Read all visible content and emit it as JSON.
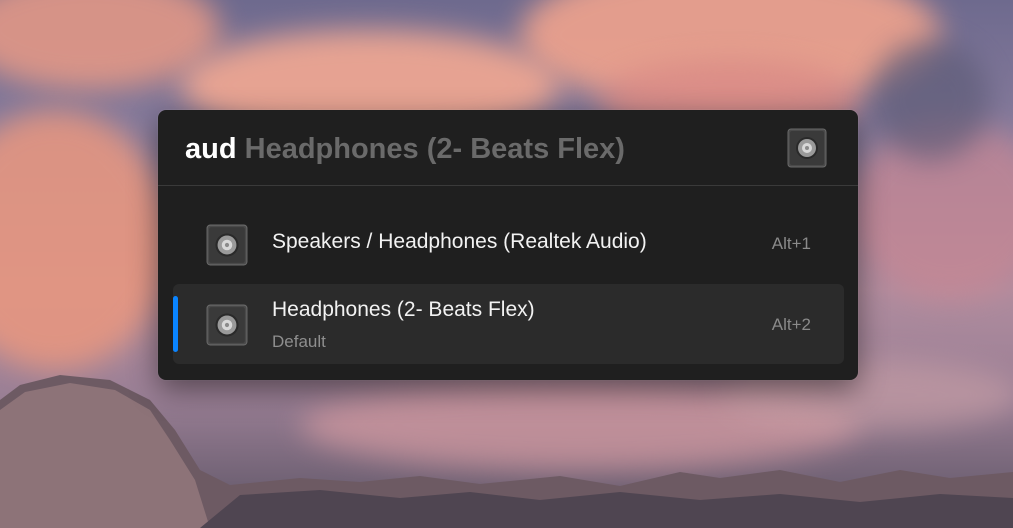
{
  "search": {
    "typed": "aud",
    "suggestion": "Headphones (2- Beats Flex)",
    "plugin_icon": "speaker-icon"
  },
  "results": [
    {
      "title": "Speakers / Headphones (Realtek Audio)",
      "subtitle": "",
      "shortcut": "Alt+1",
      "icon": "speaker-icon",
      "selected": false
    },
    {
      "title": "Headphones (2- Beats Flex)",
      "subtitle": "Default",
      "shortcut": "Alt+2",
      "icon": "speaker-icon",
      "selected": true
    }
  ],
  "colors": {
    "accent": "#0a84ff",
    "window_bg": "#1f1f1f",
    "selected_bg": "#2b2b2b"
  }
}
